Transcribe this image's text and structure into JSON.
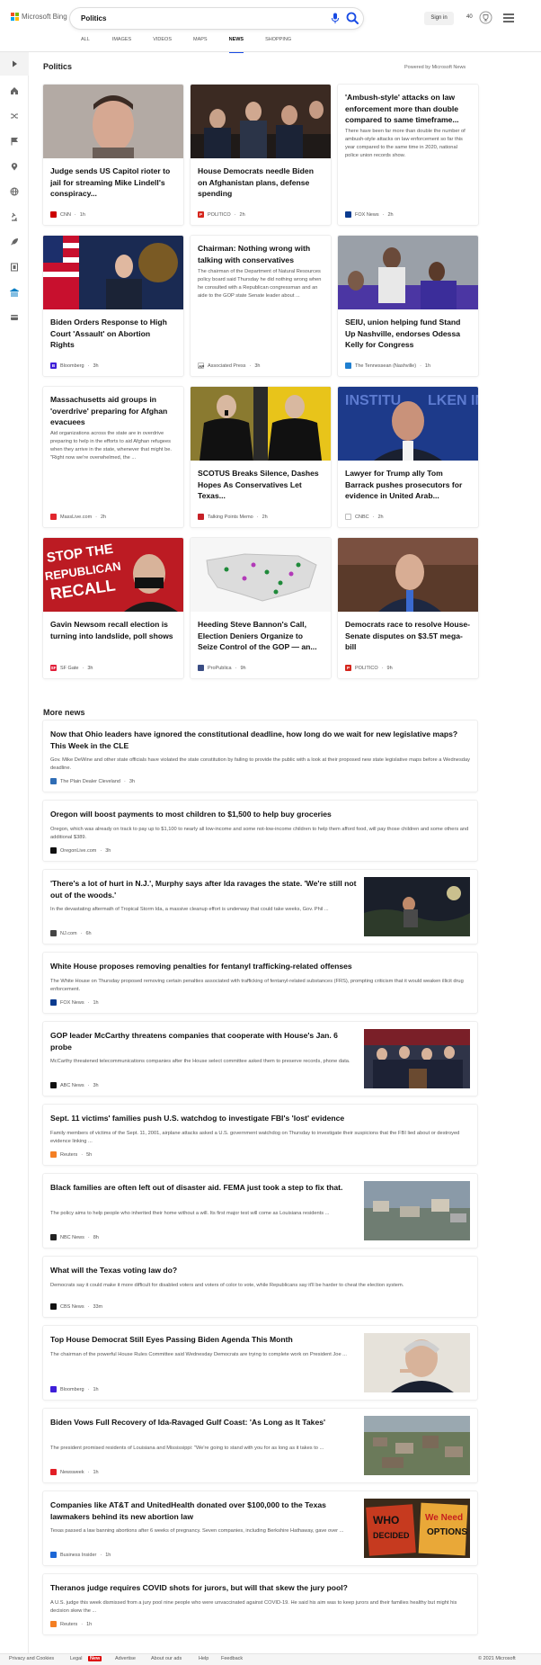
{
  "brand": {
    "name": "Microsoft Bing",
    "colors": [
      "#f25022",
      "#7fba00",
      "#00a4ef",
      "#ffb900"
    ]
  },
  "search": {
    "value": "Politics"
  },
  "header": {
    "signin_label": "Sign in",
    "points": "40"
  },
  "tabs": [
    {
      "label": "ALL"
    },
    {
      "label": "IMAGES"
    },
    {
      "label": "VIDEOS"
    },
    {
      "label": "MAPS"
    },
    {
      "label": "NEWS",
      "active": true
    },
    {
      "label": "SHOPPING"
    }
  ],
  "rail": [
    "expand-icon",
    "home-icon",
    "shuffle-icon",
    "flag-icon",
    "location-pin-icon",
    "globe-icon",
    "microscope-icon",
    "rocket-icon",
    "film-icon",
    "bank-icon",
    "card-icon"
  ],
  "section": {
    "title": "Politics",
    "powered": "Powered by Microsoft News"
  },
  "cards": [
    {
      "title": "Judge sends US Capitol rioter to jail for streaming Mike Lindell's conspiracy...",
      "source": "CNN",
      "time": "1h",
      "fav": "#cc0000",
      "fav_text": "",
      "image": "mugshot"
    },
    {
      "title": "House Democrats needle Biden on Afghanistan plans, defense spending",
      "source": "POLITICO",
      "time": "2h",
      "fav": "#d5261d",
      "fav_text": "P",
      "image": "hearing"
    },
    {
      "title": "'Ambush-style' attacks on law enforcement more than double compared to same timeframe...",
      "desc": "There have been far more than double the number of ambush-style attacks on law enforcement so far this year compared to the same time in 2020, national police union records show.",
      "source": "FOX News",
      "time": "2h",
      "fav": "#0b3b8f",
      "fav_text": ""
    },
    {
      "title": "Biden Orders Response to High Court 'Assault' on Abortion Rights",
      "source": "Bloomberg",
      "time": "3h",
      "fav": "#3e1fd8",
      "fav_text": "B",
      "image": "biden"
    },
    {
      "title": "Chairman: Nothing wrong with talking with conservatives",
      "desc": "The chairman of the Department of Natural Resources policy board said Thursday he did nothing wrong when he consulted with a Republican congressman and an aide to the GOP state Senate leader about ...",
      "source": "Associated Press",
      "time": "3h",
      "fav": "#ffffff",
      "fav_text": "AP"
    },
    {
      "title": "SEIU, union helping fund Stand Up Nashville, endorses Odessa Kelly for Congress",
      "source": "The Tennessean (Nashville)",
      "time": "1h",
      "fav": "#1f7fd0",
      "fav_text": "",
      "image": "rally"
    },
    {
      "title": "Massachusetts aid groups in 'overdrive' preparing for Afghan evacuees",
      "desc": "Aid organizations across the state are in overdrive preparing to help in the efforts to aid Afghan refugees when they arrive in the state, whenever that might be. \"Right now we're overwhelmed, the ...",
      "source": "MassLive.com",
      "time": "2h",
      "fav": "#e1262d",
      "fav_text": ""
    },
    {
      "title": "SCOTUS Breaks Silence, Dashes Hopes As Conservatives Let Texas...",
      "source": "Talking Points Memo",
      "time": "2h",
      "fav": "#c62127",
      "fav_text": "",
      "image": "justices"
    },
    {
      "title": "Lawyer for Trump ally Tom Barrack pushes prosecutors for evidence in United Arab...",
      "source": "CNBC",
      "time": "2h",
      "fav": "#ffffff",
      "fav_text": "",
      "image": "barrack"
    },
    {
      "title": "Gavin Newsom recall election is turning into landslide, poll shows",
      "source": "SF Gate",
      "time": "3h",
      "fav": "#e21f3a",
      "fav_text": "SF",
      "image": "recall"
    },
    {
      "title": "Heeding Steve Bannon's Call, Election Deniers Organize to Seize Control of the GOP — an...",
      "source": "ProPublica",
      "time": "9h",
      "fav": "#3a4d84",
      "fav_text": "",
      "image": "map"
    },
    {
      "title": "Democrats race to resolve House-Senate disputes on $3.5T mega-bill",
      "source": "POLITICO",
      "time": "9h",
      "fav": "#d5261d",
      "fav_text": "P",
      "image": "wyden"
    }
  ],
  "more": {
    "title": "More news",
    "items": [
      {
        "title": "Now that Ohio leaders have ignored the constitutional deadline, how long do we wait for new legislative maps? This Week in the CLE",
        "desc": "Gov. Mike DeWine and other state officials have violated the state constitution by failing to provide the public with a look at their proposed new state legislative maps before a Wednesday deadline.",
        "source": "The Plain Dealer Cleveland",
        "time": "3h",
        "fav": "#2f6db5"
      },
      {
        "title": "Oregon will boost payments to most children to $1,500 to help buy groceries",
        "desc": "Oregon, which was already on track to pay up to $1,100 to nearly all low-income and some not-low-income children to help them afford food, will pay those children and some others and additional $389.",
        "source": "OregonLive.com",
        "time": "3h",
        "fav": "#111111"
      },
      {
        "title": "'There's a lot of hurt in N.J.', Murphy says after Ida ravages the state. 'We're still not out of the woods.'",
        "desc": "In the devastating aftermath of Tropical Storm Ida, a massive cleanup effort is underway that could take weeks, Gov. Phil ...",
        "source": "NJ.com",
        "time": "6h",
        "fav": "#444444",
        "thumb": "storm"
      },
      {
        "title": "White House proposes removing penalties for fentanyl trafficking-related offenses",
        "desc": "The White House on Thursday proposed removing certain penalties associated with trafficking of fentanyl-related substances (FRS), prompting criticism that it would weaken illicit drug enforcement.",
        "source": "FOX News",
        "time": "1h",
        "fav": "#0b3b8f"
      },
      {
        "title": "GOP leader McCarthy threatens companies that cooperate with House's Jan. 6 probe",
        "desc": "McCarthy threatened telecommunications companies after the House select committee asked them to preserve records, phone data.",
        "source": "ABC News",
        "time": "3h",
        "fav": "#111111",
        "thumb": "presser"
      },
      {
        "title": "Sept. 11 victims' families push U.S. watchdog to investigate FBI's 'lost' evidence",
        "desc": "Family members of victims of the Sept. 11, 2001, airplane attacks asked a U.S. government watchdog on Thursday to investigate their suspicions that the FBI lied about or destroyed evidence linking ...",
        "source": "Reuters",
        "time": "5h",
        "fav": "#f47f24"
      },
      {
        "title": "Black families are often left out of disaster aid. FEMA just took a step to fix that.",
        "desc": "The policy aims to help people who inherited their home without a will. Its first major test will come as Louisiana residents ...",
        "source": "NBC News",
        "time": "8h",
        "fav": "#222222",
        "thumb": "flood"
      },
      {
        "title": "What will the Texas voting law do?",
        "desc": "Democrats say it could make it more difficult for disabled voters and voters of color to vote, while Republicans say it'll be harder to cheat the election system.",
        "source": "CBS News",
        "time": "33m",
        "fav": "#111111"
      },
      {
        "title": "Top House Democrat Still Eyes Passing Biden Agenda This Month",
        "desc": "The chairman of the powerful House Rules Committee said Wednesday Democrats are trying to complete work on President Joe ...",
        "source": "Bloomberg",
        "time": "1h",
        "fav": "#3e1fd8",
        "thumb": "mcgovern"
      },
      {
        "title": "Biden Vows Full Recovery of Ida-Ravaged Gulf Coast: 'As Long as It Takes'",
        "desc": "The president promised residents of Louisiana and Mississippi: \"We're going to stand with you for as long as it takes to ...",
        "source": "Newsweek",
        "time": "1h",
        "fav": "#e21f26",
        "thumb": "aerial"
      },
      {
        "title": "Companies like AT&T and UnitedHealth donated over $100,000 to the Texas lawmakers behind its new abortion law",
        "desc": "Texas passed a law banning abortions after 6 weeks of pregnancy. Seven companies, including Berkshire Hathaway, gave over ...",
        "source": "Business Insider",
        "time": "1h",
        "fav": "#1d67d6",
        "thumb": "signs"
      },
      {
        "title": "Theranos judge requires COVID shots for jurors, but will that skew the jury pool?",
        "desc": "A U.S. judge this week dismissed from a jury pool nine people who were unvaccinated against COVID-19. He said his aim was to keep jurors and their families healthy but might his decision skew the ...",
        "source": "Reuters",
        "time": "1h",
        "fav": "#f47f24"
      }
    ]
  },
  "footer": {
    "links": [
      "Privacy and Cookies",
      "Legal",
      "Advertise",
      "About our ads",
      "Help",
      "Feedback"
    ],
    "new_badge": "New",
    "copyright": "© 2021 Microsoft"
  }
}
